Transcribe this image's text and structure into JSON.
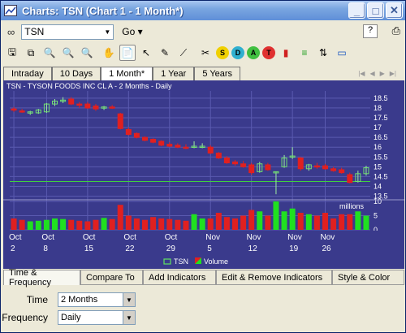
{
  "window": {
    "title": "Charts: TSN (Chart 1 - 1 Month*)",
    "min_glyph": "_",
    "max_glyph": "□",
    "close_glyph": "✕"
  },
  "address": {
    "symbol": "TSN",
    "go_label": "Go"
  },
  "toolbar": {
    "help_glyph": "?",
    "tools": [
      {
        "name": "save-icon",
        "glyph": "🖫"
      },
      {
        "name": "save-all-icon",
        "glyph": "⧉"
      },
      {
        "name": "zoom-in-icon",
        "glyph": "🔍"
      },
      {
        "name": "zoom-out-icon",
        "glyph": "🔍"
      },
      {
        "name": "zoom-100-icon",
        "glyph": "🔍"
      },
      {
        "name": "hand-pan-icon",
        "glyph": "✋"
      },
      {
        "name": "notes-icon",
        "glyph": "📄"
      },
      {
        "name": "pointer-icon",
        "glyph": "↖"
      },
      {
        "name": "pencil-draw-icon",
        "glyph": "✎"
      },
      {
        "name": "trendline-icon",
        "glyph": "⟋"
      },
      {
        "name": "delete-lines-icon",
        "glyph": "✂"
      },
      {
        "name": "dollar-icon",
        "glyph": "S"
      },
      {
        "name": "dividend-icon",
        "glyph": "D"
      },
      {
        "name": "analyst-icon",
        "glyph": "A"
      },
      {
        "name": "text-t-icon",
        "glyph": "T"
      },
      {
        "name": "bar-chart-icon",
        "glyph": "▮"
      },
      {
        "name": "indicator-icon",
        "glyph": "≡"
      },
      {
        "name": "compare-icon",
        "glyph": "⇅"
      },
      {
        "name": "screen-icon",
        "glyph": "▭"
      }
    ]
  },
  "period_tabs": [
    "Intraday",
    "10 Days",
    "1 Month*",
    "1 Year",
    "5 Years"
  ],
  "chart_data": {
    "type": "candlestick",
    "title": "TSN - TYSON FOODS INC CL A - 2 Months - Daily",
    "price_axis": {
      "ticks": [
        13.5,
        14,
        14.5,
        15,
        15.5,
        16,
        16.5,
        17,
        17.5,
        18,
        18.5
      ],
      "ylim": [
        13.4,
        18.7
      ]
    },
    "volume_axis": {
      "label": "millions",
      "ticks": [
        0,
        5,
        10
      ],
      "ylim": [
        0,
        10
      ]
    },
    "x_labels": [
      {
        "month": "Oct",
        "day": "2"
      },
      {
        "month": "Oct",
        "day": "8"
      },
      {
        "month": "Oct",
        "day": "15"
      },
      {
        "month": "Oct",
        "day": "22"
      },
      {
        "month": "Oct",
        "day": "29"
      },
      {
        "month": "Nov",
        "day": "5"
      },
      {
        "month": "Nov",
        "day": "12"
      },
      {
        "month": "Nov",
        "day": "19"
      },
      {
        "month": "Nov",
        "day": "26"
      }
    ],
    "reference_line": 14.25,
    "candles": [
      {
        "o": 17.95,
        "h": 18.05,
        "l": 17.8,
        "c": 17.9
      },
      {
        "o": 17.85,
        "h": 17.95,
        "l": 17.75,
        "c": 17.8
      },
      {
        "o": 17.75,
        "h": 17.85,
        "l": 17.65,
        "c": 17.8
      },
      {
        "o": 17.75,
        "h": 17.95,
        "l": 17.7,
        "c": 17.9
      },
      {
        "o": 17.8,
        "h": 18.25,
        "l": 17.75,
        "c": 18.2
      },
      {
        "o": 18.2,
        "h": 18.45,
        "l": 18.1,
        "c": 18.35
      },
      {
        "o": 18.35,
        "h": 18.55,
        "l": 18.25,
        "c": 18.4
      },
      {
        "o": 18.45,
        "h": 18.55,
        "l": 18.15,
        "c": 18.2
      },
      {
        "o": 18.2,
        "h": 18.3,
        "l": 18.0,
        "c": 18.15
      },
      {
        "o": 18.2,
        "h": 18.3,
        "l": 17.95,
        "c": 18.0
      },
      {
        "o": 18.1,
        "h": 18.2,
        "l": 17.85,
        "c": 17.95
      },
      {
        "o": 18.0,
        "h": 18.1,
        "l": 17.9,
        "c": 18.05
      },
      {
        "o": 18.05,
        "h": 18.15,
        "l": 17.95,
        "c": 18.0
      },
      {
        "o": 17.7,
        "h": 17.75,
        "l": 16.9,
        "c": 16.95
      },
      {
        "o": 16.9,
        "h": 17.0,
        "l": 16.6,
        "c": 16.65
      },
      {
        "o": 16.7,
        "h": 16.75,
        "l": 16.45,
        "c": 16.5
      },
      {
        "o": 16.5,
        "h": 16.55,
        "l": 16.3,
        "c": 16.35
      },
      {
        "o": 16.4,
        "h": 16.45,
        "l": 16.2,
        "c": 16.25
      },
      {
        "o": 16.3,
        "h": 16.35,
        "l": 16.05,
        "c": 16.1
      },
      {
        "o": 16.15,
        "h": 16.25,
        "l": 16.0,
        "c": 16.05
      },
      {
        "o": 16.1,
        "h": 16.2,
        "l": 15.95,
        "c": 16.0
      },
      {
        "o": 16.0,
        "h": 16.15,
        "l": 15.9,
        "c": 15.95
      },
      {
        "o": 16.0,
        "h": 16.3,
        "l": 15.95,
        "c": 16.05
      },
      {
        "o": 16.05,
        "h": 16.2,
        "l": 15.95,
        "c": 16.05
      },
      {
        "o": 16.0,
        "h": 16.1,
        "l": 15.65,
        "c": 15.7
      },
      {
        "o": 15.7,
        "h": 15.75,
        "l": 15.4,
        "c": 15.45
      },
      {
        "o": 15.45,
        "h": 15.55,
        "l": 15.15,
        "c": 15.2
      },
      {
        "o": 15.25,
        "h": 15.35,
        "l": 15.05,
        "c": 15.15
      },
      {
        "o": 15.15,
        "h": 15.3,
        "l": 14.95,
        "c": 15.0
      },
      {
        "o": 15.1,
        "h": 15.2,
        "l": 14.6,
        "c": 14.7
      },
      {
        "o": 14.75,
        "h": 15.25,
        "l": 14.7,
        "c": 15.15
      },
      {
        "o": 15.1,
        "h": 15.2,
        "l": 14.8,
        "c": 14.85
      },
      {
        "o": 14.7,
        "h": 14.75,
        "l": 13.6,
        "c": 14.75
      },
      {
        "o": 15.0,
        "h": 15.6,
        "l": 14.95,
        "c": 15.45
      },
      {
        "o": 15.5,
        "h": 16.0,
        "l": 15.4,
        "c": 15.55
      },
      {
        "o": 15.45,
        "h": 15.5,
        "l": 14.8,
        "c": 14.9
      },
      {
        "o": 14.9,
        "h": 15.15,
        "l": 14.8,
        "c": 15.1
      },
      {
        "o": 15.05,
        "h": 15.2,
        "l": 14.9,
        "c": 15.0
      },
      {
        "o": 15.05,
        "h": 15.15,
        "l": 14.85,
        "c": 14.9
      },
      {
        "o": 14.9,
        "h": 15.0,
        "l": 14.75,
        "c": 14.8
      },
      {
        "o": 14.85,
        "h": 14.95,
        "l": 14.65,
        "c": 14.7
      },
      {
        "o": 14.6,
        "h": 14.7,
        "l": 14.15,
        "c": 14.2
      },
      {
        "o": 14.25,
        "h": 14.8,
        "l": 14.2,
        "c": 14.65
      },
      {
        "o": 14.65,
        "h": 15.05,
        "l": 14.55,
        "c": 14.95
      }
    ],
    "volume": [
      4.0,
      3.5,
      3.0,
      3.2,
      3.5,
      4.0,
      3.8,
      3.5,
      3.2,
      3.0,
      3.5,
      4.2,
      3.8,
      8.8,
      5.0,
      4.0,
      3.5,
      4.5,
      4.0,
      3.8,
      3.5,
      3.2,
      5.5,
      4.0,
      4.0,
      6.0,
      4.5,
      4.0,
      5.0,
      7.0,
      6.5,
      5.0,
      11.5,
      6.5,
      7.5,
      6.0,
      5.5,
      5.0,
      6.0,
      4.0,
      5.5,
      5.5,
      6.5,
      5.0
    ],
    "legend": [
      {
        "name": "TSN",
        "color": "#60e060"
      },
      {
        "name": "Volume",
        "color": "#e02020"
      }
    ]
  },
  "bottom_tabs": [
    "Time & Frequency",
    "Compare To",
    "Add Indicators",
    "Edit & Remove Indicators",
    "Style & Color"
  ],
  "form": {
    "time_label": "Time",
    "time_value": "2 Months",
    "frequency_label": "Frequency",
    "frequency_value": "Daily"
  }
}
